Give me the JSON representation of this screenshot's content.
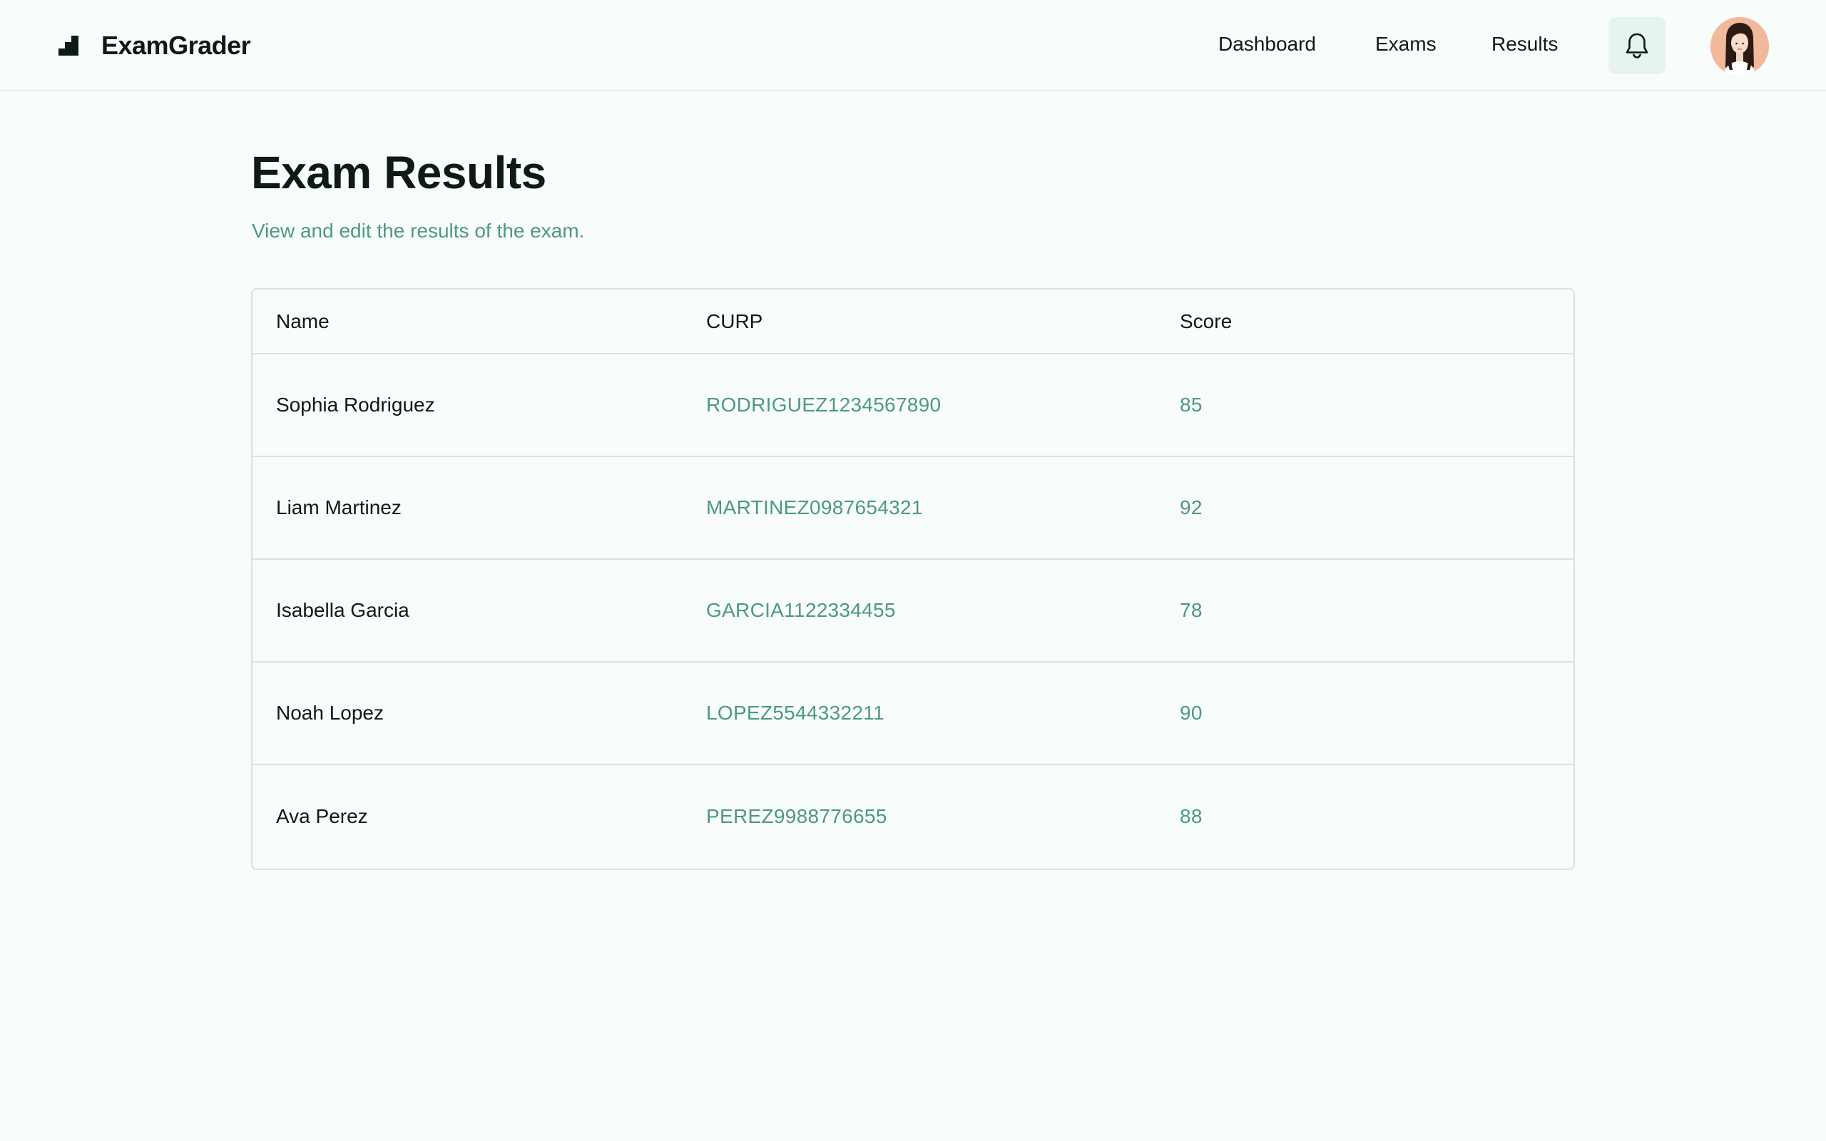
{
  "header": {
    "brand_name": "ExamGrader",
    "nav": [
      {
        "label": "Dashboard"
      },
      {
        "label": "Exams"
      },
      {
        "label": "Results"
      }
    ],
    "notification_icon": "bell-icon",
    "avatar_icon": "user-avatar"
  },
  "main": {
    "title": "Exam Results",
    "subtitle": "View and edit the results of the exam.",
    "table": {
      "columns": [
        "Name",
        "CURP",
        "Score"
      ],
      "rows": [
        {
          "name": "Sophia Rodriguez",
          "curp": "RODRIGUEZ1234567890",
          "score": "85"
        },
        {
          "name": "Liam Martinez",
          "curp": "MARTINEZ0987654321",
          "score": "92"
        },
        {
          "name": "Isabella Garcia",
          "curp": "GARCIA1122334455",
          "score": "78"
        },
        {
          "name": "Noah Lopez",
          "curp": "LOPEZ5544332211",
          "score": "90"
        },
        {
          "name": "Ava Perez",
          "curp": "PEREZ9988776655",
          "score": "88"
        }
      ]
    }
  },
  "colors": {
    "background": "#f8fcfb",
    "text": "#0e1a14",
    "accent": "#4c9a7c",
    "border": "#d2e6df",
    "bell_bg": "#e7f3ee"
  }
}
